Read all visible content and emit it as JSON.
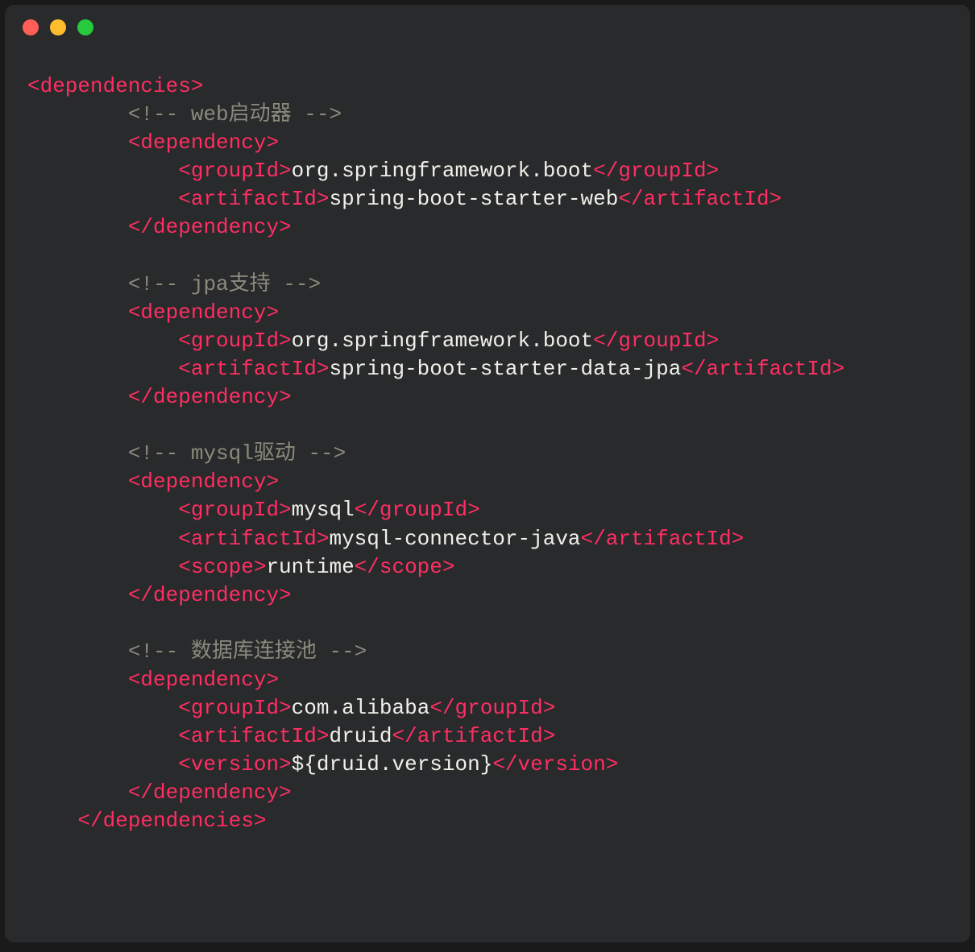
{
  "code": {
    "root_open": "<dependencies>",
    "root_close": "</dependencies>",
    "blocks": [
      {
        "comment": "<!-- web启动器 -->",
        "open": "<dependency>",
        "lines": [
          {
            "otag": "<groupId>",
            "val": "org.springframework.boot",
            "ctag": "</groupId>"
          },
          {
            "otag": "<artifactId>",
            "val": "spring-boot-starter-web",
            "ctag": "</artifactId>"
          }
        ],
        "close": "</dependency>"
      },
      {
        "comment": "<!-- jpa支持 -->",
        "open": "<dependency>",
        "lines": [
          {
            "otag": "<groupId>",
            "val": "org.springframework.boot",
            "ctag": "</groupId>"
          },
          {
            "otag": "<artifactId>",
            "val": "spring-boot-starter-data-jpa",
            "ctag": "</artifactId>"
          }
        ],
        "close": "</dependency>"
      },
      {
        "comment": "<!-- mysql驱动 -->",
        "open": "<dependency>",
        "lines": [
          {
            "otag": "<groupId>",
            "val": "mysql",
            "ctag": "</groupId>"
          },
          {
            "otag": "<artifactId>",
            "val": "mysql-connector-java",
            "ctag": "</artifactId>"
          },
          {
            "otag": "<scope>",
            "val": "runtime",
            "ctag": "</scope>"
          }
        ],
        "close": "</dependency>"
      },
      {
        "comment": "<!-- 数据库连接池 -->",
        "open": "<dependency>",
        "lines": [
          {
            "otag": "<groupId>",
            "val": "com.alibaba",
            "ctag": "</groupId>"
          },
          {
            "otag": "<artifactId>",
            "val": "druid",
            "ctag": "</artifactId>"
          },
          {
            "otag": "<version>",
            "val": "${druid.version}",
            "ctag": "</version>"
          }
        ],
        "close": "</dependency>"
      }
    ]
  },
  "colors": {
    "tag": "#ff2e63",
    "comment": "#8a8a7d",
    "text": "#f0f0ea",
    "bg": "#292a2b"
  }
}
